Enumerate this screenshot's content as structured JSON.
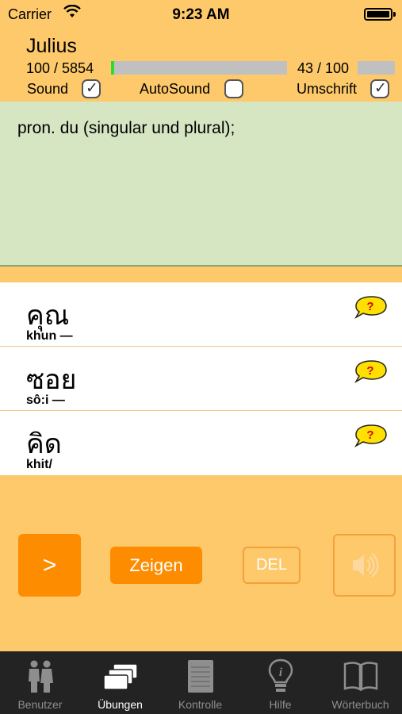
{
  "status_bar": {
    "carrier": "Carrier",
    "time": "9:23 AM"
  },
  "header": {
    "user_name": "Julius",
    "total_progress": "100 / 5854",
    "total_progress_fraction": 0.017,
    "session_progress": "43 / 100"
  },
  "options": {
    "sound": {
      "label": "Sound",
      "checked": true
    },
    "autosound": {
      "label": "AutoSound",
      "checked": false
    },
    "transcription": {
      "label": "Umschrift",
      "checked": true
    }
  },
  "definition": {
    "text": "pron. du (singular und plural);"
  },
  "words": [
    {
      "thai": "คุณ",
      "translit": "khun —"
    },
    {
      "thai": "ซอย",
      "translit": "sô:i —"
    },
    {
      "thai": "คิด",
      "translit": "khit/"
    }
  ],
  "actions": {
    "next_label": ">",
    "show_label": "Zeigen",
    "delete_label": "DEL"
  },
  "tabs": [
    {
      "label": "Benutzer",
      "icon": "users-icon",
      "active": false
    },
    {
      "label": "Übungen",
      "icon": "cards-icon",
      "active": true
    },
    {
      "label": "Kontrolle",
      "icon": "notepad-icon",
      "active": false
    },
    {
      "label": "Hilfe",
      "icon": "lightbulb-icon",
      "active": false
    },
    {
      "label": "Wörterbuch",
      "icon": "book-icon",
      "active": false
    }
  ],
  "colors": {
    "background": "#fdc96b",
    "definition_bg": "#d6e6c2",
    "accent": "#fd8c00",
    "progress_fill": "#2ddc2d"
  }
}
